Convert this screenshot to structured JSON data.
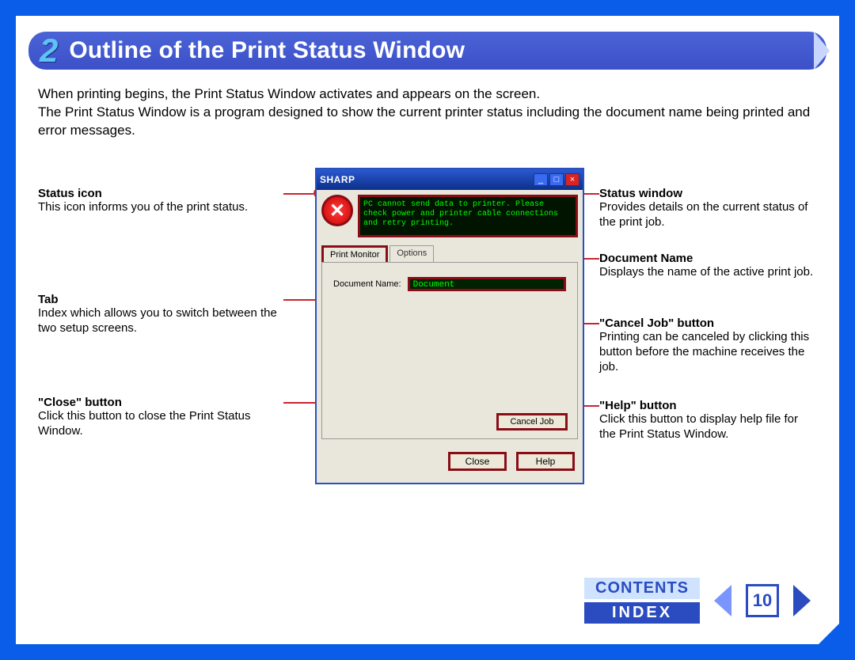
{
  "title": {
    "number": "2",
    "heading": "Outline of the Print Status Window"
  },
  "intro": "When printing begins, the Print Status Window activates and appears on the screen.\nThe Print Status Window is a program designed to show the current printer status including the document name being printed and error messages.",
  "callouts": {
    "left": [
      {
        "head": "Status icon",
        "body": "This icon informs you of the print status."
      },
      {
        "head": "Tab",
        "body": "Index which allows you to switch between the two setup screens."
      },
      {
        "head": "\"Close\" button",
        "body": "Click this button to close the Print Status Window."
      }
    ],
    "right": [
      {
        "head": "Status window",
        "body": "Provides details on the current status of the print job."
      },
      {
        "head": "Document Name",
        "body": "Displays the name of the active print job."
      },
      {
        "head": "\"Cancel Job\" button",
        "body": "Printing can be canceled by clicking this button before the machine receives the job."
      },
      {
        "head": "\"Help\" button",
        "body": "Click this button to display help file for the Print Status Window."
      }
    ]
  },
  "window": {
    "brand": "SHARP",
    "status_icon_glyph": "✕",
    "status_message": "PC cannot send data to printer. Please check power and printer cable connections and retry printing.",
    "tabs": {
      "active": "Print Monitor",
      "inactive": "Options"
    },
    "docname_label": "Document Name:",
    "docname_value": "Document",
    "cancel_label": "Cancel Job",
    "close_label": "Close",
    "help_label": "Help"
  },
  "nav": {
    "contents": "CONTENTS",
    "index": "INDEX",
    "page": "10"
  }
}
